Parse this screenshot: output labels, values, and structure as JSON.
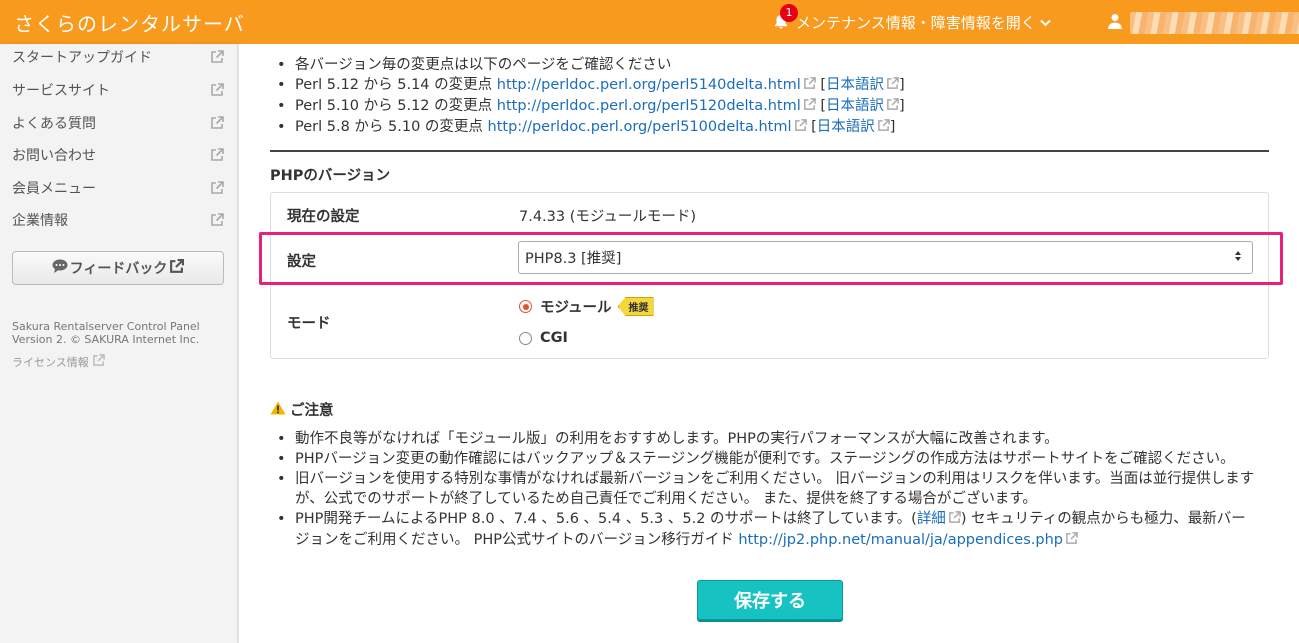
{
  "header": {
    "brand": "さくらのレンタルサーバ",
    "notice_badge": "1",
    "notice_label": "メンテナンス情報・障害情報を開く",
    "colors": {
      "header_bg": "#f79a1e",
      "badge": "#e60012"
    }
  },
  "sidebar": {
    "items": [
      {
        "label": "スタートアップガイド"
      },
      {
        "label": "サービスサイト"
      },
      {
        "label": "よくある質問"
      },
      {
        "label": "お問い合わせ"
      },
      {
        "label": "会員メニュー"
      },
      {
        "label": "企業情報"
      }
    ],
    "feedback_label": "フィードバック",
    "copyright_line1": "Sakura Rentalserver Control Panel",
    "copyright_line2": "Version 2. © SAKURA Internet Inc.",
    "license_label": "ライセンス情報"
  },
  "perl_notes": {
    "intro": "各バージョン毎の変更点は以下のページをご確認ください",
    "items": [
      {
        "text": "Perl 5.12 から 5.14 の変更点 ",
        "url": "http://perldoc.perl.org/perl5140delta.html",
        "jp_label": "日本語訳"
      },
      {
        "text": "Perl 5.10 から 5.12 の変更点 ",
        "url": "http://perldoc.perl.org/perl5120delta.html",
        "jp_label": "日本語訳"
      },
      {
        "text": "Perl 5.8 から 5.10 の変更点 ",
        "url": "http://perldoc.perl.org/perl5100delta.html",
        "jp_label": "日本語訳"
      }
    ]
  },
  "php": {
    "section_title": "PHPのバージョン",
    "current_label": "現在の設定",
    "current_value": "7.4.33 (モジュールモード)",
    "setting_label": "設定",
    "selected_version": "PHP8.3 [推奨]",
    "mode_label": "モード",
    "mode_module": "モジュール",
    "recommended_tag": "推奨",
    "mode_cgi": "CGI",
    "selected_mode": "module",
    "accent_color": "#e8207a"
  },
  "caution": {
    "title": "ご注意",
    "items": [
      {
        "text": "動作不良等がなければ「モジュール版」の利用をおすすめします。PHPの実行パフォーマンスが大幅に改善されます。"
      },
      {
        "text": "PHPバージョン変更の動作確認にはバックアップ＆ステージング機能が便利です。ステージングの作成方法はサポートサイトをご確認ください。"
      },
      {
        "text": "旧バージョンを使用する特別な事情がなければ最新バージョンをご利用ください。 旧バージョンの利用はリスクを伴います。当面は並行提供しますが、公式でのサポートが終了しているため自己責任でご利用ください。 また、提供を終了する場合がございます。"
      }
    ],
    "php_team_pre": "PHP開発チームによるPHP 8.0 、7.4 、5.6 、5.4 、5.3 、5.2 のサポートは終了しています。(",
    "php_team_link": "詳細",
    "php_team_post": ") セキュリティの観点からも極力、最新バージョンをご利用ください。 PHP公式サイトのバージョン移行ガイド ",
    "php_guide_url": "http://jp2.php.net/manual/ja/appendices.php"
  },
  "save_label": "保存する",
  "save_color": "#16c2c2"
}
